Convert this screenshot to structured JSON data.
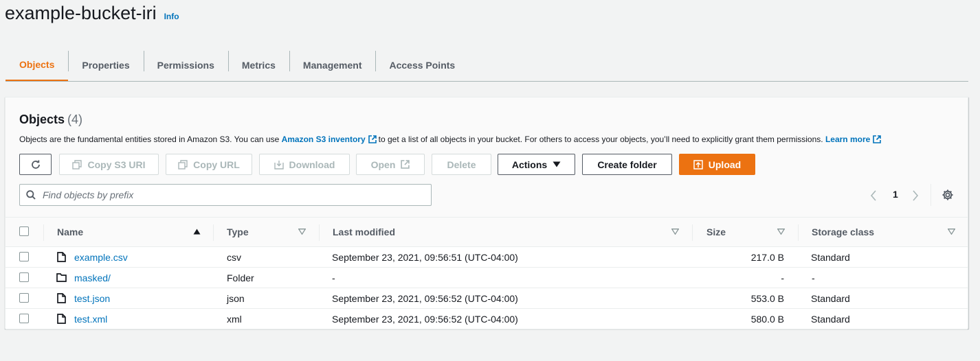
{
  "header": {
    "title": "example-bucket-iri",
    "info_label": "Info"
  },
  "tabs": [
    {
      "label": "Objects",
      "active": true
    },
    {
      "label": "Properties",
      "active": false
    },
    {
      "label": "Permissions",
      "active": false
    },
    {
      "label": "Metrics",
      "active": false
    },
    {
      "label": "Management",
      "active": false
    },
    {
      "label": "Access Points",
      "active": false
    }
  ],
  "objects_panel": {
    "heading": "Objects",
    "count": "(4)",
    "description": {
      "part1": "Objects are the fundamental entities stored in Amazon S3. You can use",
      "inventory_link": "Amazon S3 inventory",
      "part2": "to get a list of all objects in your bucket. For others to access your objects, you’ll need to explicitly grant them permissions.",
      "learn_more_link": "Learn more"
    },
    "toolbar": {
      "refresh_icon": "refresh-icon",
      "copy_s3_uri": "Copy S3 URI",
      "copy_url": "Copy URL",
      "download": "Download",
      "open": "Open",
      "delete": "Delete",
      "actions": "Actions",
      "create_folder": "Create folder",
      "upload": "Upload"
    },
    "search": {
      "placeholder": "Find objects by prefix",
      "value": ""
    },
    "pagination": {
      "current_page": "1"
    },
    "table": {
      "columns": [
        "Name",
        "Type",
        "Last modified",
        "Size",
        "Storage class"
      ],
      "rows": [
        {
          "icon": "file-icon",
          "name": "example.csv",
          "type": "csv",
          "last_modified": "September 23, 2021, 09:56:51 (UTC-04:00)",
          "size": "217.0 B",
          "storage_class": "Standard"
        },
        {
          "icon": "folder-icon",
          "name": "masked/",
          "type": "Folder",
          "last_modified": "-",
          "size": "-",
          "storage_class": "-"
        },
        {
          "icon": "file-icon",
          "name": "test.json",
          "type": "json",
          "last_modified": "September 23, 2021, 09:56:52 (UTC-04:00)",
          "size": "553.0 B",
          "storage_class": "Standard"
        },
        {
          "icon": "file-icon",
          "name": "test.xml",
          "type": "xml",
          "last_modified": "September 23, 2021, 09:56:52 (UTC-04:00)",
          "size": "580.0 B",
          "storage_class": "Standard"
        }
      ]
    }
  },
  "colors": {
    "accent_orange": "#ec7211",
    "link_blue": "#0073bb",
    "page_background": "#f2f3f3"
  }
}
